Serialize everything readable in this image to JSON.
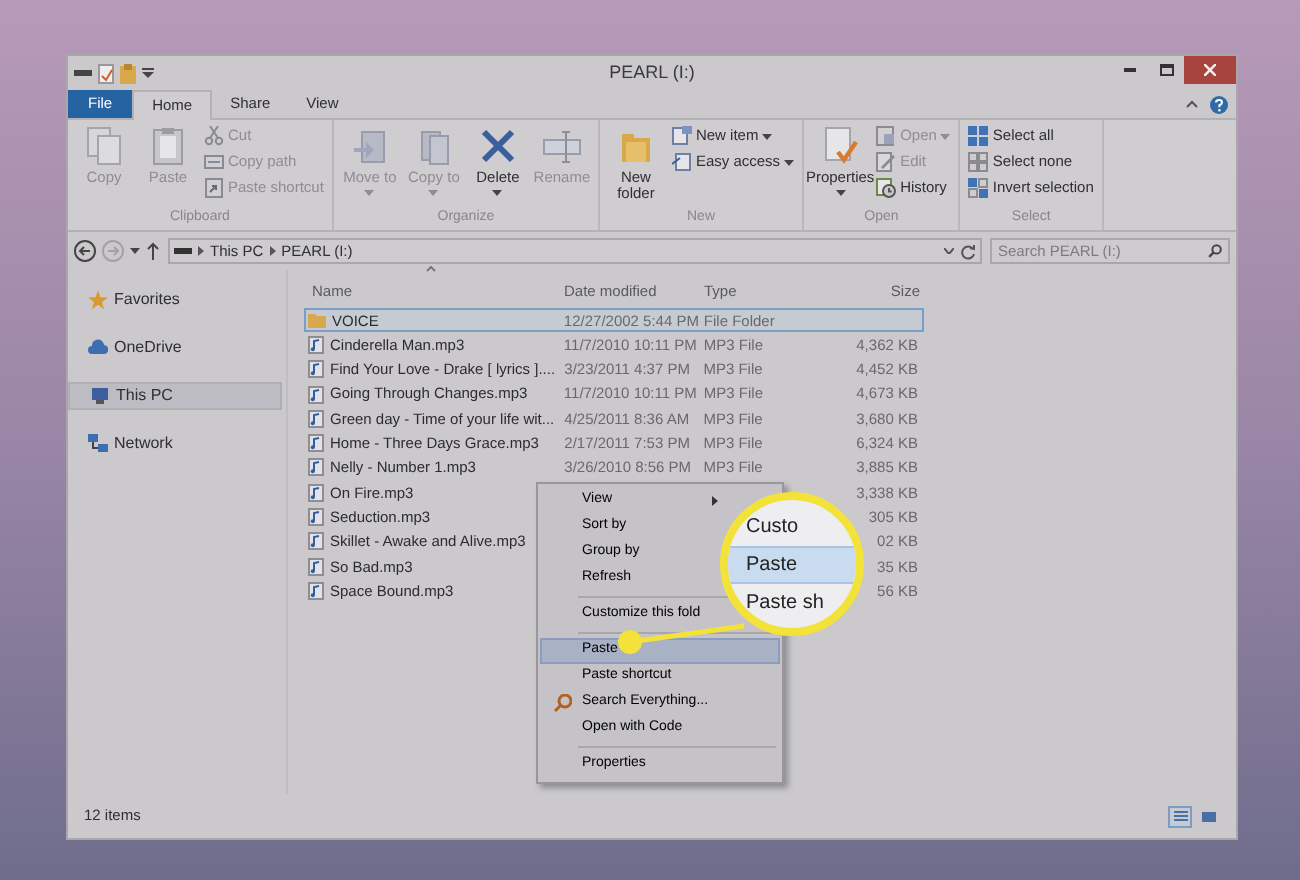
{
  "window": {
    "title": "PEARL (I:)"
  },
  "ribbon_tabs": [
    {
      "label": "File",
      "kind": "file",
      "selected": false
    },
    {
      "label": "Home",
      "kind": "tab",
      "selected": true
    },
    {
      "label": "Share",
      "kind": "tab",
      "selected": false
    },
    {
      "label": "View",
      "kind": "tab",
      "selected": false
    }
  ],
  "ribbon_groups": [
    {
      "label": "Clipboard",
      "items": [
        {
          "kind": "large",
          "label": "Copy",
          "disabled": true,
          "dropdown": false
        },
        {
          "kind": "large",
          "label": "Paste",
          "disabled": true,
          "dropdown": false
        },
        {
          "kind": "stack",
          "items": [
            {
              "label": "Cut",
              "disabled": true,
              "dropdown": false
            },
            {
              "label": "Copy path",
              "disabled": true,
              "dropdown": false
            },
            {
              "label": "Paste shortcut",
              "disabled": true,
              "dropdown": false
            }
          ]
        }
      ]
    },
    {
      "label": "Organize",
      "items": [
        {
          "kind": "large",
          "label": "Move to",
          "disabled": true,
          "dropdown": true
        },
        {
          "kind": "large",
          "label": "Copy to",
          "disabled": true,
          "dropdown": true
        },
        {
          "kind": "large",
          "label": "Delete",
          "disabled": false,
          "dropdown": true
        },
        {
          "kind": "large",
          "label": "Rename",
          "disabled": true,
          "dropdown": false
        }
      ]
    },
    {
      "label": "New",
      "items": [
        {
          "kind": "large",
          "label": "New folder",
          "disabled": false,
          "dropdown": false
        },
        {
          "kind": "stack",
          "items": [
            {
              "label": "New item",
              "disabled": false,
              "dropdown": true
            },
            {
              "label": "Easy access",
              "disabled": false,
              "dropdown": true
            }
          ]
        }
      ]
    },
    {
      "label": "Open",
      "items": [
        {
          "kind": "large",
          "label": "Properties",
          "disabled": false,
          "dropdown": true
        },
        {
          "kind": "stack",
          "items": [
            {
              "label": "Open",
              "disabled": true,
              "dropdown": true
            },
            {
              "label": "Edit",
              "disabled": true,
              "dropdown": false
            },
            {
              "label": "History",
              "disabled": false,
              "dropdown": false
            }
          ]
        }
      ]
    },
    {
      "label": "Select",
      "items": [
        {
          "kind": "stack",
          "items": [
            {
              "label": "Select all",
              "disabled": false,
              "dropdown": false
            },
            {
              "label": "Select none",
              "disabled": false,
              "dropdown": false
            },
            {
              "label": "Invert selection",
              "disabled": false,
              "dropdown": false
            }
          ]
        }
      ]
    }
  ],
  "address_bar": {
    "nav_buttons": [
      {
        "kind": "back",
        "disabled": false
      },
      {
        "kind": "forward",
        "disabled": true
      },
      {
        "kind": "recent",
        "disabled": false
      },
      {
        "kind": "up",
        "disabled": false
      }
    ],
    "breadcrumb": [
      "This PC",
      "PEARL (I:)"
    ],
    "search": {
      "placeholder": "Search PEARL (I:)"
    }
  },
  "nav_pane": [
    {
      "label": "Favorites",
      "kind": "favorites",
      "selected": false
    },
    {
      "label": "OneDrive",
      "kind": "cloud",
      "selected": false
    },
    {
      "label": "This PC",
      "kind": "computer",
      "selected": true
    },
    {
      "label": "Network",
      "kind": "network",
      "selected": false
    }
  ],
  "columns": [
    "Name",
    "Date modified",
    "Type",
    "Size"
  ],
  "rows": [
    {
      "kind": "folder",
      "name": "VOICE",
      "date": "12/27/2002 5:44 PM",
      "type": "File Folder",
      "selected": true
    },
    {
      "kind": "audio",
      "name": "Cinderella Man.mp3",
      "date": "11/7/2010 10:11 PM",
      "type": "MP3 File",
      "size": "4,362 KB",
      "selected": false
    },
    {
      "kind": "audio",
      "name": "Find Your Love - Drake [ lyrics ]....",
      "date": "3/23/2011 4:37 PM",
      "type": "MP3 File",
      "size": "4,452 KB",
      "selected": false
    },
    {
      "kind": "audio",
      "name": "Going Through Changes.mp3",
      "date": "11/7/2010 10:11 PM",
      "type": "MP3 File",
      "size": "4,673 KB",
      "selected": false
    },
    {
      "kind": "audio",
      "name": "Green day - Time of your life wit...",
      "date": "4/25/2011 8:36 AM",
      "type": "MP3 File",
      "size": "3,680 KB",
      "selected": false
    },
    {
      "kind": "audio",
      "name": "Home - Three Days Grace.mp3",
      "date": "2/17/2011 7:53 PM",
      "type": "MP3 File",
      "size": "6,324 KB",
      "selected": false
    },
    {
      "kind": "audio",
      "name": "Nelly - Number 1.mp3",
      "date": "3/26/2010 8:56 PM",
      "type": "MP3 File",
      "size": "3,885 KB",
      "selected": false
    },
    {
      "kind": "audio",
      "name": "On Fire.mp3",
      "size": "3,338 KB",
      "selected": false
    },
    {
      "kind": "audio",
      "name": "Seduction.mp3",
      "size": "305 KB",
      "selected": false
    },
    {
      "kind": "audio",
      "name": "Skillet - Awake and Alive.mp3",
      "size": "02 KB",
      "selected": false
    },
    {
      "kind": "audio",
      "name": "So Bad.mp3",
      "size": "35 KB",
      "selected": false
    },
    {
      "kind": "audio",
      "name": "Space Bound.mp3",
      "size": "56 KB",
      "selected": false
    }
  ],
  "context_menu": [
    {
      "kind": "submenu",
      "label": "View",
      "selected": false
    },
    {
      "kind": "item",
      "label": "Sort by",
      "selected": false
    },
    {
      "kind": "item",
      "label": "Group by",
      "selected": false
    },
    {
      "kind": "item",
      "label": "Refresh",
      "selected": false
    },
    {
      "kind": "separator"
    },
    {
      "kind": "item",
      "label": "Customize this fold",
      "selected": false
    },
    {
      "kind": "separator"
    },
    {
      "kind": "item",
      "label": "Paste",
      "selected": true
    },
    {
      "kind": "item",
      "label": "Paste shortcut",
      "selected": false
    },
    {
      "kind": "icon_item",
      "label": "Search Everything...",
      "selected": false
    },
    {
      "kind": "item",
      "label": "Open with Code",
      "selected": false
    },
    {
      "kind": "separator"
    },
    {
      "kind": "item",
      "label": "Properties",
      "selected": false
    }
  ],
  "callout": {
    "items": [
      {
        "label": "Custo",
        "selected": false
      },
      {
        "label": "Paste",
        "selected": true
      },
      {
        "label": "Paste sh",
        "selected": false
      }
    ]
  },
  "status_bar": {
    "text": "12 items",
    "views": [
      {
        "kind": "details",
        "selected": true
      },
      {
        "kind": "tiles",
        "selected": false
      }
    ]
  }
}
